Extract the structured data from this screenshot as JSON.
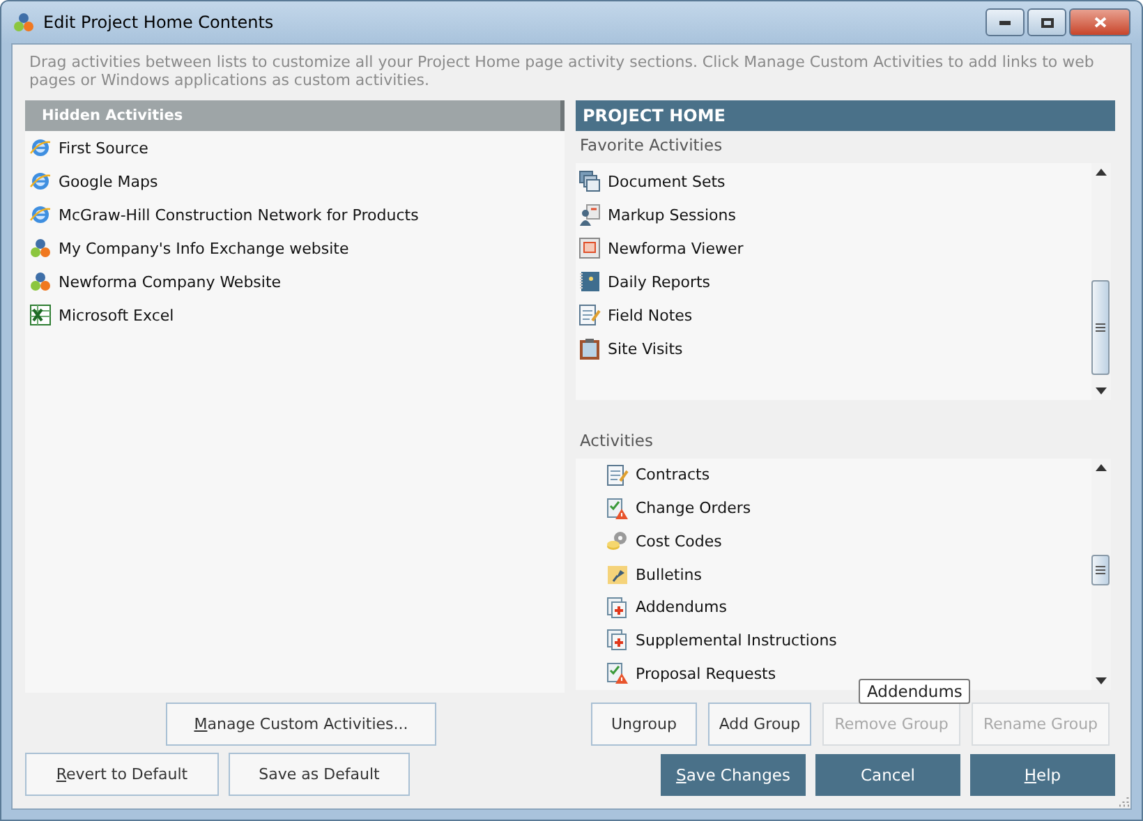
{
  "window": {
    "title": "Edit Project Home Contents"
  },
  "description": "Drag activities between lists to customize all your Project Home page activity sections.  Click Manage Custom Activities to add links to web pages or Windows applications as custom activities.",
  "hidden_panel": {
    "title": "Hidden Activities",
    "items": [
      {
        "label": "First Source",
        "kind": "web"
      },
      {
        "label": "Google Maps",
        "kind": "web"
      },
      {
        "label": "McGraw-Hill Construction Network for Products",
        "kind": "web"
      },
      {
        "label": "My Company's Info Exchange website",
        "kind": "app"
      },
      {
        "label": "Newforma Company Website",
        "kind": "app"
      },
      {
        "label": "Microsoft Excel",
        "kind": "sheet"
      }
    ]
  },
  "project_panel": {
    "title": "PROJECT HOME",
    "favorites": {
      "title": "Favorite Activities",
      "items": [
        {
          "label": "Document Sets",
          "kind": "stack"
        },
        {
          "label": "Markup Sessions",
          "kind": "people"
        },
        {
          "label": "Newforma Viewer",
          "kind": "viewer"
        },
        {
          "label": "Daily Reports",
          "kind": "book"
        },
        {
          "label": "Field Notes",
          "kind": "note"
        },
        {
          "label": "Site Visits",
          "kind": "clipboard"
        }
      ]
    },
    "activities": {
      "title": "Activities",
      "items": [
        {
          "label": "Contracts",
          "kind": "note"
        },
        {
          "label": "Change Orders",
          "kind": "warn"
        },
        {
          "label": "Cost Codes",
          "kind": "gear"
        },
        {
          "label": "Bulletins",
          "kind": "pin"
        },
        {
          "label": "Addendums",
          "kind": "plus"
        },
        {
          "label": "Supplemental Instructions",
          "kind": "plus"
        },
        {
          "label": "Proposal Requests",
          "kind": "warn"
        }
      ]
    },
    "tooltip": "Addendums"
  },
  "buttons_left": [
    {
      "label": "Manage Custom Activities...",
      "underline_first": true,
      "disabled": false
    }
  ],
  "buttons_right": [
    {
      "label": "Ungroup",
      "underline_first": false,
      "disabled": false
    },
    {
      "label": "Add Group",
      "underline_first": false,
      "disabled": false
    },
    {
      "label": "Remove Group",
      "underline_first": false,
      "disabled": true
    },
    {
      "label": "Rename Group",
      "underline_first": false,
      "disabled": true
    }
  ],
  "footer_left": [
    {
      "label": "Revert to Default",
      "underline_first": true
    },
    {
      "label": "Save as Default",
      "underline_first": false
    }
  ],
  "footer_right": [
    {
      "label": "Save Changes",
      "underline_first": true
    },
    {
      "label": "Cancel",
      "underline_first": false
    },
    {
      "label": "Help",
      "underline_first": true
    }
  ]
}
